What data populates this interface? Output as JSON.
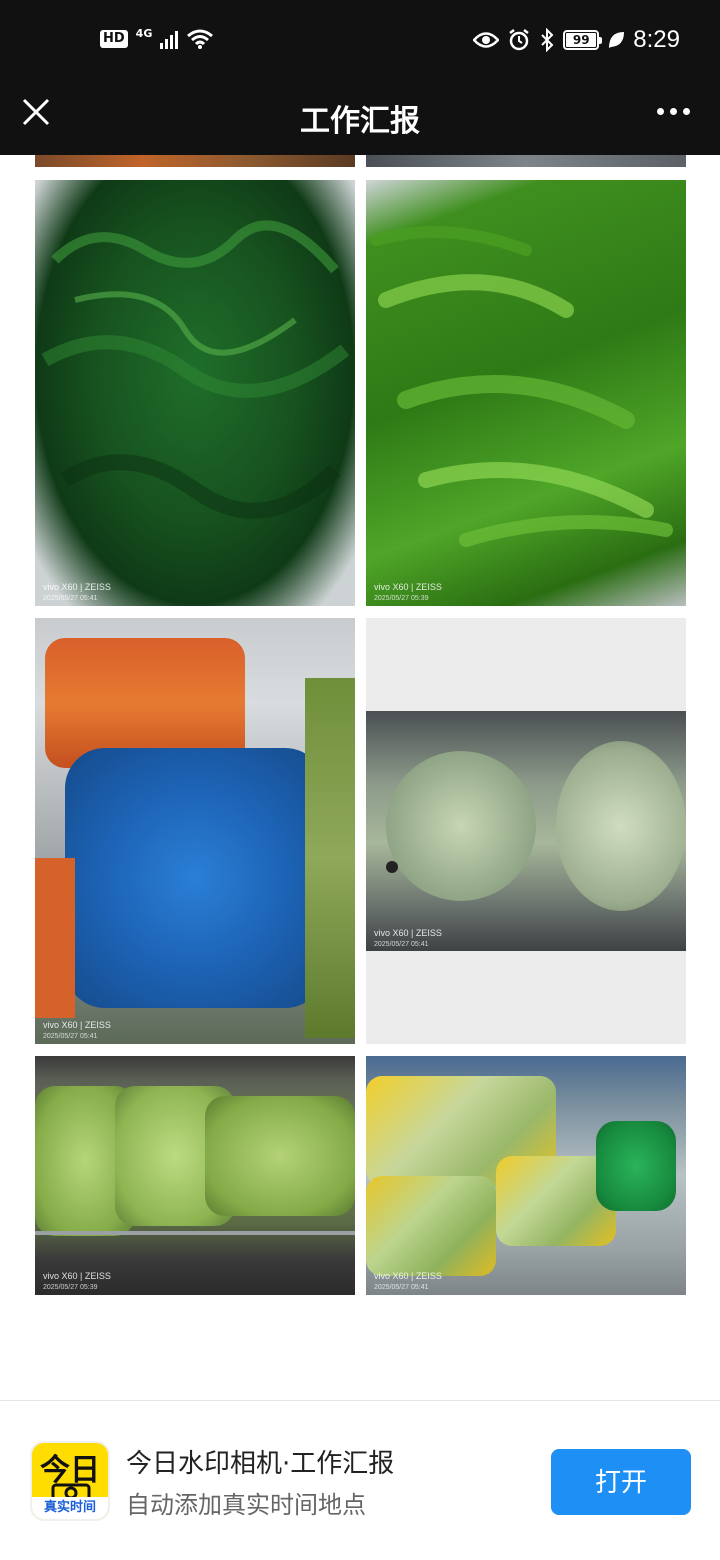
{
  "status_bar": {
    "hd": "HD",
    "network": "4G",
    "battery": "99",
    "time": "8:29"
  },
  "header": {
    "title": "工作汇报"
  },
  "photos": [
    {
      "camera": "vivo X60 | ZEISS",
      "date": "2025/05/27 05:41"
    },
    {
      "camera": "vivo X60 | ZEISS",
      "date": "2025/05/27 05:39"
    },
    {
      "camera": "vivo X60 | ZEISS",
      "date": "2025/05/27 05:41"
    },
    {
      "camera": "vivo X60 | ZEISS",
      "date": "2025/05/27 05:41"
    },
    {
      "camera": "vivo X60 | ZEISS",
      "date": "2025/05/27 05:39"
    },
    {
      "camera": "vivo X60 | ZEISS",
      "date": "2025/05/27 05:41"
    }
  ],
  "footer": {
    "icon_top": "今日",
    "icon_bottom": "真实时间",
    "app_name": "今日水印相机·工作汇报",
    "app_desc": "自动添加真实时间地点",
    "open_label": "打开"
  },
  "colors": {
    "bar_bg": "#111111",
    "accent": "#1e90f5",
    "icon_yellow": "#ffdd00"
  }
}
